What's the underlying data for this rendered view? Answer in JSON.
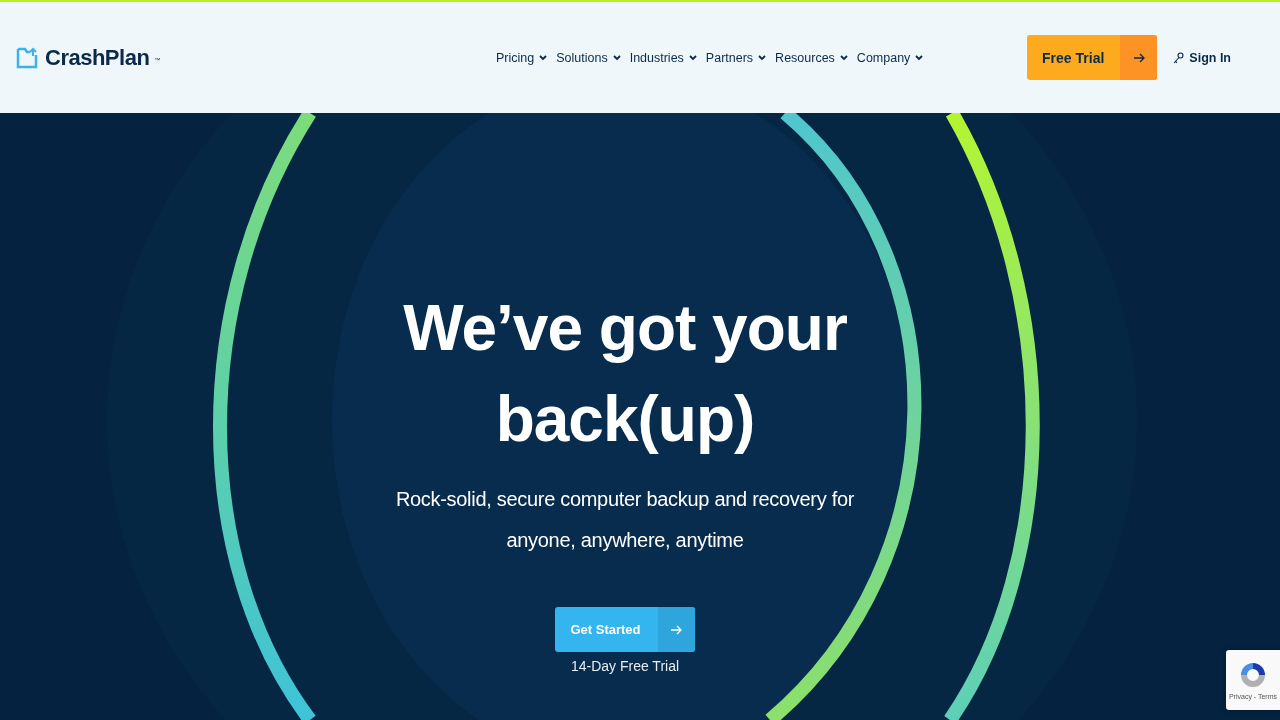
{
  "header": {
    "logo": {
      "name": "CrashPlan",
      "mark": "™"
    },
    "nav": [
      {
        "label": "Pricing"
      },
      {
        "label": "Solutions"
      },
      {
        "label": "Industries"
      },
      {
        "label": "Partners"
      },
      {
        "label": "Resources"
      },
      {
        "label": "Company"
      }
    ],
    "trial_button": {
      "label": "Free Trial"
    },
    "sign_in": {
      "label": "Sign In"
    }
  },
  "hero": {
    "headline": "We’ve got your back(up)",
    "subtitle": "Rock-solid, secure computer backup and recovery for anyone, anywhere, anytime",
    "cta": {
      "label": "Get Started"
    },
    "cta_note": "14-Day Free Trial"
  },
  "recaptcha": {
    "links": "Privacy - Terms"
  }
}
